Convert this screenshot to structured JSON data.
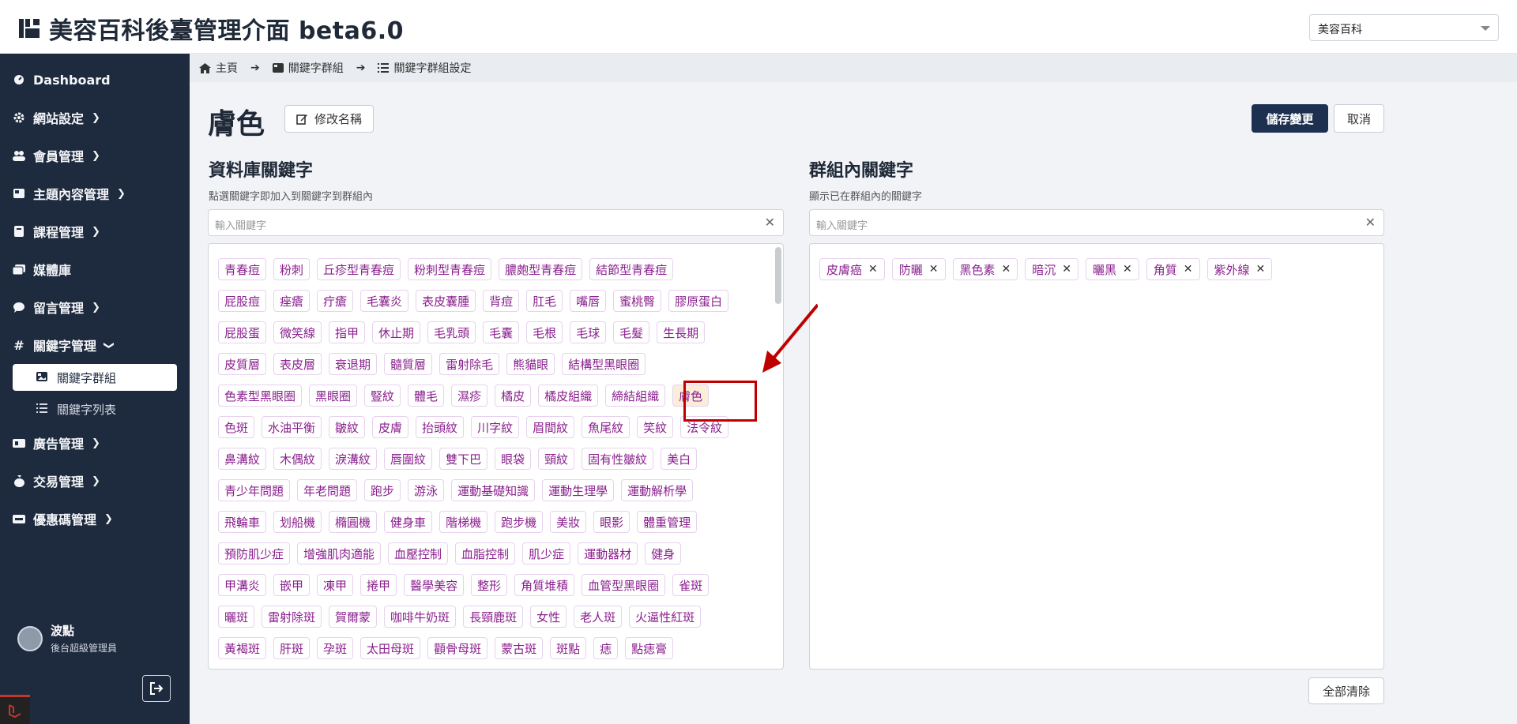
{
  "header": {
    "title": "美容百科後臺管理介面 beta6.0",
    "site_select": "美容百科"
  },
  "sidebar": {
    "items": [
      {
        "label": "Dashboard",
        "icon": "dashboard-icon",
        "has_chevron": false
      },
      {
        "label": "網站設定",
        "icon": "gear-icon",
        "has_chevron": true
      },
      {
        "label": "會員管理",
        "icon": "users-icon",
        "has_chevron": true
      },
      {
        "label": "主題內容管理",
        "icon": "content-icon",
        "has_chevron": true
      },
      {
        "label": "課程管理",
        "icon": "book-icon",
        "has_chevron": true
      },
      {
        "label": "媒體庫",
        "icon": "images-icon",
        "has_chevron": false
      },
      {
        "label": "留言管理",
        "icon": "comment-icon",
        "has_chevron": true
      },
      {
        "label": "關鍵字管理",
        "icon": "hashtag-icon",
        "has_chevron": true,
        "expanded": true
      },
      {
        "label": "廣告管理",
        "icon": "ad-icon",
        "has_chevron": true
      },
      {
        "label": "交易管理",
        "icon": "money-bag-icon",
        "has_chevron": true
      },
      {
        "label": "優惠碼管理",
        "icon": "ticket-icon",
        "has_chevron": true
      }
    ],
    "sub_items": [
      {
        "label": "關鍵字群組",
        "active": true
      },
      {
        "label": "關鍵字列表",
        "active": false
      }
    ],
    "user": {
      "name": "波點",
      "role": "後台超級管理員"
    }
  },
  "breadcrumb": [
    "主頁",
    "關鍵字群組",
    "關鍵字群組設定"
  ],
  "page": {
    "title": "膚色",
    "rename_label": "修改名稱",
    "save_label": "儲存變更",
    "cancel_label": "取消",
    "clear_all_label": "全部清除"
  },
  "left_panel": {
    "title": "資料庫關鍵字",
    "subtitle": "點選關鍵字即加入到關鍵字到群組內",
    "placeholder": "輸入關鍵字",
    "highlighted": "膚色",
    "rows": [
      [
        "青春痘",
        "粉刺",
        "丘疹型青春痘",
        "粉刺型青春痘",
        "膿皰型青春痘",
        "結節型青春痘"
      ],
      [
        "屁股痘",
        "痤瘡",
        "疔瘡",
        "毛囊炎",
        "表皮囊腫",
        "背痘",
        "肛毛",
        "嘴唇",
        "蜜桃臀",
        "膠原蛋白"
      ],
      [
        "屁股蛋",
        "微笑線",
        "指甲",
        "休止期",
        "毛乳頭",
        "毛囊",
        "毛根",
        "毛球",
        "毛髮",
        "生長期"
      ],
      [
        "皮質層",
        "表皮層",
        "衰退期",
        "髓質層",
        "雷射除毛",
        "熊貓眼",
        "結構型黑眼圈"
      ],
      [
        "色素型黑眼圈",
        "黑眼圈",
        "豎紋",
        "體毛",
        "濕疹",
        "橘皮",
        "橘皮組織",
        "締結組織",
        "膚色"
      ],
      [
        "色斑",
        "水油平衡",
        "皺紋",
        "皮膚",
        "抬頭紋",
        "川字紋",
        "眉間紋",
        "魚尾紋",
        "笑紋",
        "法令紋"
      ],
      [
        "鼻溝紋",
        "木偶紋",
        "淚溝紋",
        "唇圍紋",
        "雙下巴",
        "眼袋",
        "頸紋",
        "固有性皺紋",
        "美白"
      ],
      [
        "青少年問題",
        "年老問題",
        "跑步",
        "游泳",
        "運動基礎知識",
        "運動生理學",
        "運動解析學"
      ],
      [
        "飛輪車",
        "划船機",
        "橢圓機",
        "健身車",
        "階梯機",
        "跑步機",
        "美妝",
        "眼影",
        "體重管理"
      ],
      [
        "預防肌少症",
        "增強肌肉適能",
        "血壓控制",
        "血脂控制",
        "肌少症",
        "運動器材",
        "健身"
      ],
      [
        "甲溝炎",
        "嵌甲",
        "凍甲",
        "捲甲",
        "醫學美容",
        "整形",
        "角質堆積",
        "血管型黑眼圈",
        "雀斑"
      ],
      [
        "曬斑",
        "雷射除斑",
        "賀爾蒙",
        "咖啡牛奶斑",
        "長頸鹿斑",
        "女性",
        "老人斑",
        "火逼性紅斑"
      ],
      [
        "黃褐斑",
        "肝斑",
        "孕斑",
        "太田母斑",
        "顴骨母斑",
        "蒙古斑",
        "斑點",
        "痣",
        "點痣膏"
      ]
    ]
  },
  "right_panel": {
    "title": "群組內關鍵字",
    "subtitle": "顯示已在群組內的關鍵字",
    "placeholder": "輸入關鍵字",
    "tags": [
      "皮膚癌",
      "防曬",
      "黑色素",
      "暗沉",
      "曬黑",
      "角質",
      "紫外線"
    ]
  },
  "colors": {
    "sidebar_bg": "#1e2a3d",
    "tag_text": "#8a1f8e",
    "primary_button": "#1e3050",
    "annotation": "#c00000"
  }
}
